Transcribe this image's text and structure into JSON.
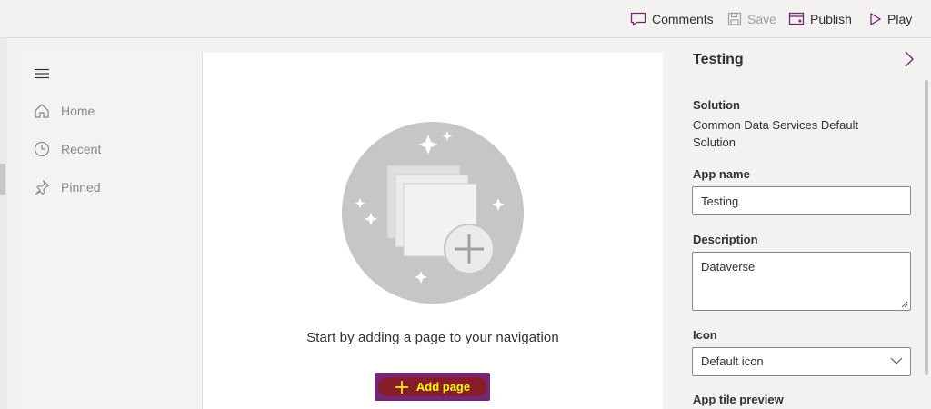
{
  "toolbar": {
    "comments_label": "Comments",
    "save_label": "Save",
    "publish_label": "Publish",
    "play_label": "Play"
  },
  "nav": {
    "items": [
      {
        "label": "Home",
        "icon": "home-icon"
      },
      {
        "label": "Recent",
        "icon": "clock-icon"
      },
      {
        "label": "Pinned",
        "icon": "pin-icon"
      }
    ]
  },
  "main": {
    "empty_text": "Start by adding a page to your navigation",
    "add_page_label": "Add page"
  },
  "panel": {
    "title": "Testing",
    "solution_label": "Solution",
    "solution_value": "Common Data Services Default Solution",
    "app_name_label": "App name",
    "app_name_value": "Testing",
    "description_label": "Description",
    "description_value": "Dataverse",
    "icon_label": "Icon",
    "icon_value": "Default icon",
    "tile_preview_label": "App tile preview"
  },
  "colors": {
    "accent": "#742774",
    "highlight": "#8b1c1c",
    "highlight_text": "#ffff00"
  }
}
